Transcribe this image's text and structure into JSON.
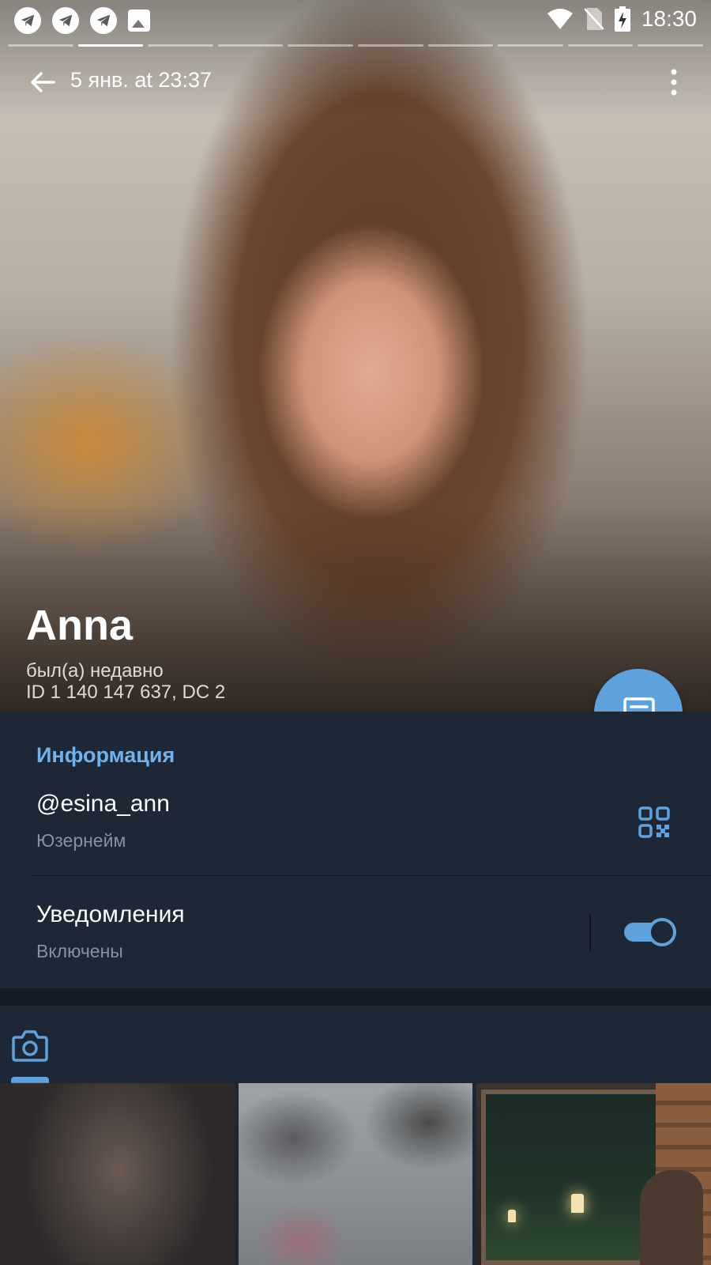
{
  "status_bar": {
    "time": "18:30",
    "notification_icons": [
      "telegram-icon",
      "telegram-icon",
      "telegram-icon",
      "image-icon"
    ],
    "system_icons": [
      "wifi-icon",
      "no-sim-icon",
      "battery-charging-icon"
    ]
  },
  "story_progress": {
    "segments": 10,
    "active_index": 1
  },
  "header": {
    "date_label": "5 янв. at 23:37"
  },
  "profile": {
    "name": "Anna",
    "last_seen": "был(а) недавно",
    "id_line": "ID 1 140 147 637, DC 2"
  },
  "info": {
    "section_title": "Информация",
    "username": "@esina_ann",
    "username_caption": "Юзернейм",
    "notifications_label": "Уведомления",
    "notifications_status": "Включены",
    "notifications_enabled": true
  },
  "colors": {
    "accent": "#5ea2dd",
    "section_title": "#6fb2ec",
    "background": "#1d2735",
    "secondary_text": "#8692a0"
  },
  "media": {
    "active_tab": "photo-tab",
    "thumbnails": [
      "blurred-photo",
      "blurred-photo",
      "sauna-photo"
    ]
  }
}
